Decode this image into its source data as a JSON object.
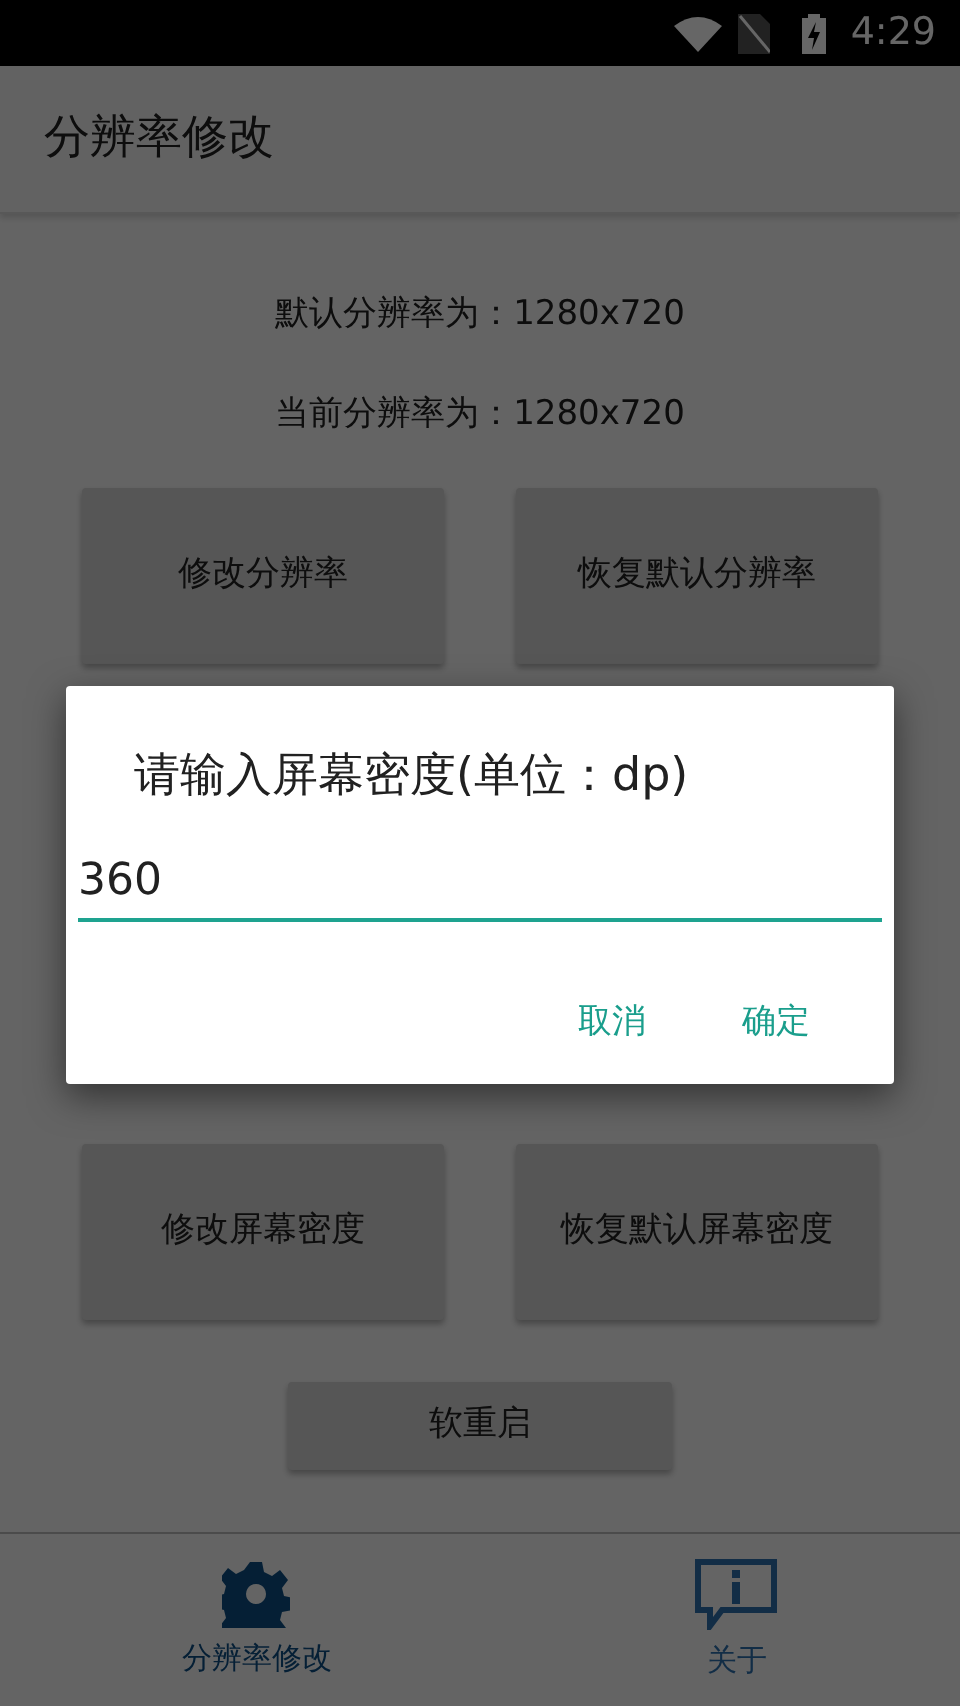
{
  "status_bar": {
    "time": "4:29"
  },
  "app_bar": {
    "title": "分辨率修改"
  },
  "info": [
    "默认分辨率为：1280x720",
    "当前分辨率为：1280x720"
  ],
  "buttons_top": [
    "修改分辨率",
    "恢复默认分辨率"
  ],
  "buttons_bottom": [
    "修改屏幕密度",
    "恢复默认屏幕密度"
  ],
  "reboot_button": "软重启",
  "bottom_nav": [
    {
      "label": "分辨率修改",
      "kind": "gear",
      "selected": true
    },
    {
      "label": "关于",
      "kind": "info",
      "selected": false
    }
  ],
  "dialog": {
    "title": "请输入屏幕密度(单位：dp)",
    "value": "360",
    "buttons": [
      "取消",
      "确定"
    ]
  }
}
